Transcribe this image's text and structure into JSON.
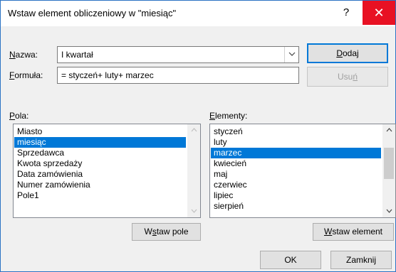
{
  "window": {
    "title": "Wstaw element obliczeniowy w \"miesiąc\"",
    "help_label": "?",
    "close_label": "✕"
  },
  "form": {
    "name_label_u": "N",
    "name_label_rest": "azwa:",
    "name_value": "I kwartał",
    "formula_label_u": "F",
    "formula_label_rest": "ormuła:",
    "formula_value": "= styczeń+ luty+ marzec"
  },
  "buttons": {
    "add_u": "D",
    "add_rest": "odaj",
    "remove_pre": "Usu",
    "remove_u": "ń",
    "insert_field_pre": "W",
    "insert_field_u": "s",
    "insert_field_rest": "taw pole",
    "insert_item_u": "W",
    "insert_item_rest": "staw element",
    "ok": "OK",
    "close": "Zamknij"
  },
  "fields": {
    "label_u": "P",
    "label_rest": "ola:",
    "items": [
      "Miasto",
      "miesiąc",
      "Sprzedawca",
      "Kwota sprzedaży",
      "Data zamówienia",
      "Numer zamówienia",
      "Pole1"
    ],
    "selected_index": 1
  },
  "elements": {
    "label_u": "E",
    "label_rest": "lementy:",
    "items": [
      "styczeń",
      "luty",
      "marzec",
      "kwiecień",
      "maj",
      "czerwiec",
      "lipiec",
      "sierpień"
    ],
    "selected_index": 2,
    "scroll_position": 0.3
  },
  "colors": {
    "accent": "#0078d7",
    "close_button": "#e81123",
    "dialog_background": "#f0f0f0"
  },
  "icons": {
    "combo": "chevron-down-icon",
    "scroll_up": "scroll-up-arrow-icon",
    "scroll_down": "scroll-down-arrow-icon"
  }
}
